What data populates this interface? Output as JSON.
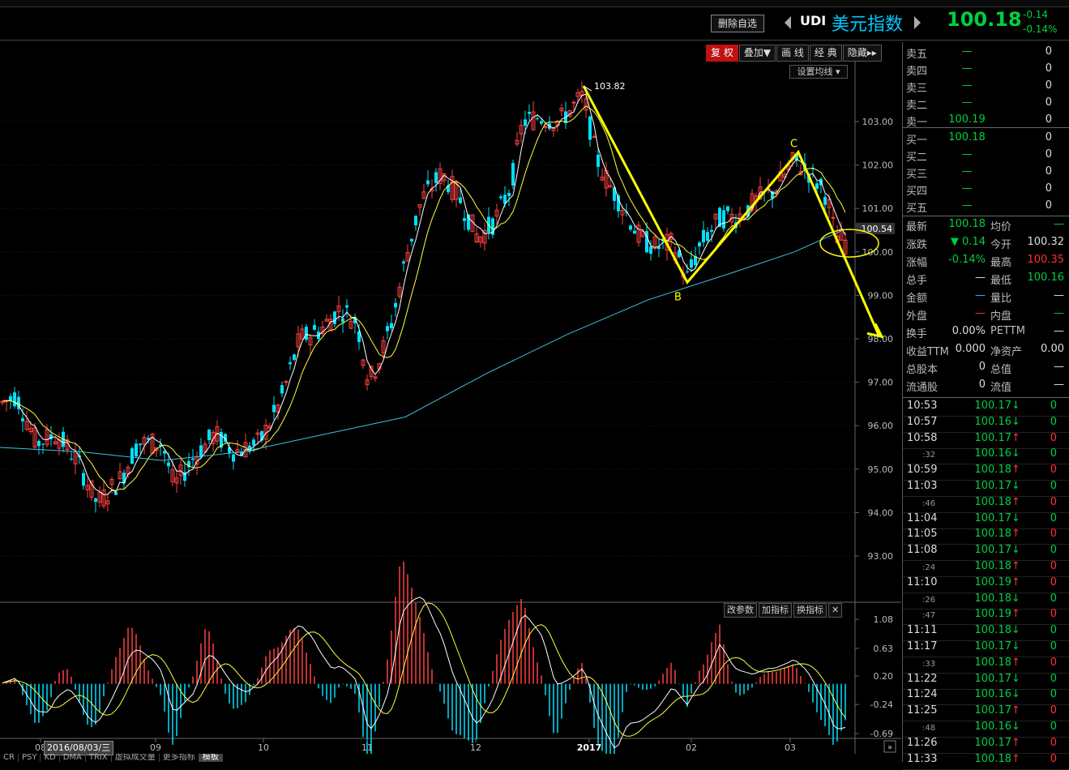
{
  "header": {
    "delete_btn": "删除自选",
    "symbol_code": "UDI",
    "symbol_name": "美元指数",
    "price": "100.18",
    "change": "-0.14",
    "change_pct": "-0.14%"
  },
  "toolbar": {
    "buttons": [
      "复 权",
      "叠加▼",
      "画 线",
      "经 典",
      "隐藏▸▸"
    ]
  },
  "ma_setting": "设置均线 ▾",
  "indicator_buttons": [
    "改参数",
    "加指标",
    "换指标",
    "✕"
  ],
  "bottom_tabs": [
    "CR",
    "PSY",
    "KD",
    "DMA",
    "TRIX",
    "虚拟成交量",
    "更多指标",
    "模板"
  ],
  "date_tag": "2016/08/03/三",
  "chart_data": {
    "type": "candlestick",
    "price_axis": [
      "103.00",
      "102.00",
      "101.00",
      "100.00",
      "99.00",
      "98.00",
      "97.00",
      "96.00",
      "95.00",
      "94.00",
      "93.00"
    ],
    "current_price_label": "100.54",
    "high_annotation": "103.82",
    "wave_labels": [
      "B",
      "C"
    ],
    "time_axis": [
      "08",
      "09",
      "10",
      "11",
      "12",
      "2017",
      "02",
      "03"
    ],
    "indicator_axis": [
      "1.08",
      "0.63",
      "0.20",
      "-0.24",
      "-0.69"
    ],
    "colors": {
      "up": "#ff4040",
      "down": "#00e0ff",
      "ma_short": "#ffffff",
      "ma_mid": "#ffff40",
      "ma_long": "#40c0e0",
      "annotation": "#ffff00"
    }
  },
  "quote": {
    "asks": [
      {
        "label": "卖五",
        "price": "—",
        "vol": "0"
      },
      {
        "label": "卖四",
        "price": "—",
        "vol": "0"
      },
      {
        "label": "卖三",
        "price": "—",
        "vol": "0"
      },
      {
        "label": "卖二",
        "price": "—",
        "vol": "0"
      },
      {
        "label": "卖一",
        "price": "100.19",
        "vol": "0"
      }
    ],
    "bids": [
      {
        "label": "买一",
        "price": "100.18",
        "vol": "0"
      },
      {
        "label": "买二",
        "price": "—",
        "vol": "0"
      },
      {
        "label": "买三",
        "price": "—",
        "vol": "0"
      },
      {
        "label": "买四",
        "price": "—",
        "vol": "0"
      },
      {
        "label": "买五",
        "price": "—",
        "vol": "0"
      }
    ]
  },
  "stats": [
    {
      "l1": "最新",
      "v1": "100.18",
      "c1": "grn",
      "l2": "均价",
      "v2": "—",
      "c2": "grn"
    },
    {
      "l1": "涨跌",
      "v1": "▼ 0.14",
      "c1": "grn",
      "l2": "今开",
      "v2": "100.32",
      "c2": "wht"
    },
    {
      "l1": "涨幅",
      "v1": "-0.14%",
      "c1": "grn",
      "l2": "最高",
      "v2": "100.35",
      "c2": "red"
    },
    {
      "l1": "总手",
      "v1": "—",
      "c1": "wht",
      "l2": "最低",
      "v2": "100.16",
      "c2": "grn"
    },
    {
      "l1": "金额",
      "v1": "—",
      "c1": "cyn",
      "l2": "量比",
      "v2": "—",
      "c2": "wht"
    },
    {
      "l1": "外盘",
      "v1": "—",
      "c1": "red",
      "l2": "内盘",
      "v2": "—",
      "c2": "grn"
    },
    {
      "l1": "换手",
      "v1": "0.00%",
      "c1": "wht",
      "l2": "PETTM",
      "v2": "—",
      "c2": "wht"
    },
    {
      "l1": "收益TTM",
      "v1": "0.000",
      "c1": "wht",
      "l2": "净资产",
      "v2": "0.00",
      "c2": "wht"
    },
    {
      "l1": "总股本",
      "v1": "0",
      "c1": "wht",
      "l2": "总值",
      "v2": "—",
      "c2": "wht"
    },
    {
      "l1": "流通股",
      "v1": "0",
      "c1": "wht",
      "l2": "流值",
      "v2": "—",
      "c2": "wht"
    }
  ],
  "ticks": [
    {
      "time": "10:53",
      "sub": false,
      "price": "100.17",
      "dir": "down",
      "vol": "0"
    },
    {
      "time": "10:57",
      "sub": false,
      "price": "100.16",
      "dir": "down",
      "vol": "0"
    },
    {
      "time": "10:58",
      "sub": false,
      "price": "100.17",
      "dir": "up",
      "vol": "0"
    },
    {
      "time": ":32",
      "sub": true,
      "price": "100.16",
      "dir": "down",
      "vol": "0"
    },
    {
      "time": "10:59",
      "sub": false,
      "price": "100.18",
      "dir": "up",
      "vol": "0"
    },
    {
      "time": "11:03",
      "sub": false,
      "price": "100.17",
      "dir": "down",
      "vol": "0"
    },
    {
      "time": ":46",
      "sub": true,
      "price": "100.18",
      "dir": "up",
      "vol": "0"
    },
    {
      "time": "11:04",
      "sub": false,
      "price": "100.17",
      "dir": "down",
      "vol": "0"
    },
    {
      "time": "11:05",
      "sub": false,
      "price": "100.18",
      "dir": "up",
      "vol": "0"
    },
    {
      "time": "11:08",
      "sub": false,
      "price": "100.17",
      "dir": "down",
      "vol": "0"
    },
    {
      "time": ":24",
      "sub": true,
      "price": "100.18",
      "dir": "up",
      "vol": "0"
    },
    {
      "time": "11:10",
      "sub": false,
      "price": "100.19",
      "dir": "up",
      "vol": "0"
    },
    {
      "time": ":26",
      "sub": true,
      "price": "100.18",
      "dir": "down",
      "vol": "0"
    },
    {
      "time": ":47",
      "sub": true,
      "price": "100.19",
      "dir": "up",
      "vol": "0"
    },
    {
      "time": "11:11",
      "sub": false,
      "price": "100.18",
      "dir": "down",
      "vol": "0"
    },
    {
      "time": "11:17",
      "sub": false,
      "price": "100.17",
      "dir": "down",
      "vol": "0"
    },
    {
      "time": ":33",
      "sub": true,
      "price": "100.18",
      "dir": "up",
      "vol": "0"
    },
    {
      "time": "11:22",
      "sub": false,
      "price": "100.17",
      "dir": "down",
      "vol": "0"
    },
    {
      "time": "11:24",
      "sub": false,
      "price": "100.16",
      "dir": "down",
      "vol": "0"
    },
    {
      "time": "11:25",
      "sub": false,
      "price": "100.17",
      "dir": "up",
      "vol": "0"
    },
    {
      "time": ":48",
      "sub": true,
      "price": "100.16",
      "dir": "down",
      "vol": "0"
    },
    {
      "time": "11:26",
      "sub": false,
      "price": "100.17",
      "dir": "up",
      "vol": "0"
    },
    {
      "time": "11:33",
      "sub": false,
      "price": "100.18",
      "dir": "up",
      "vol": "0"
    }
  ]
}
